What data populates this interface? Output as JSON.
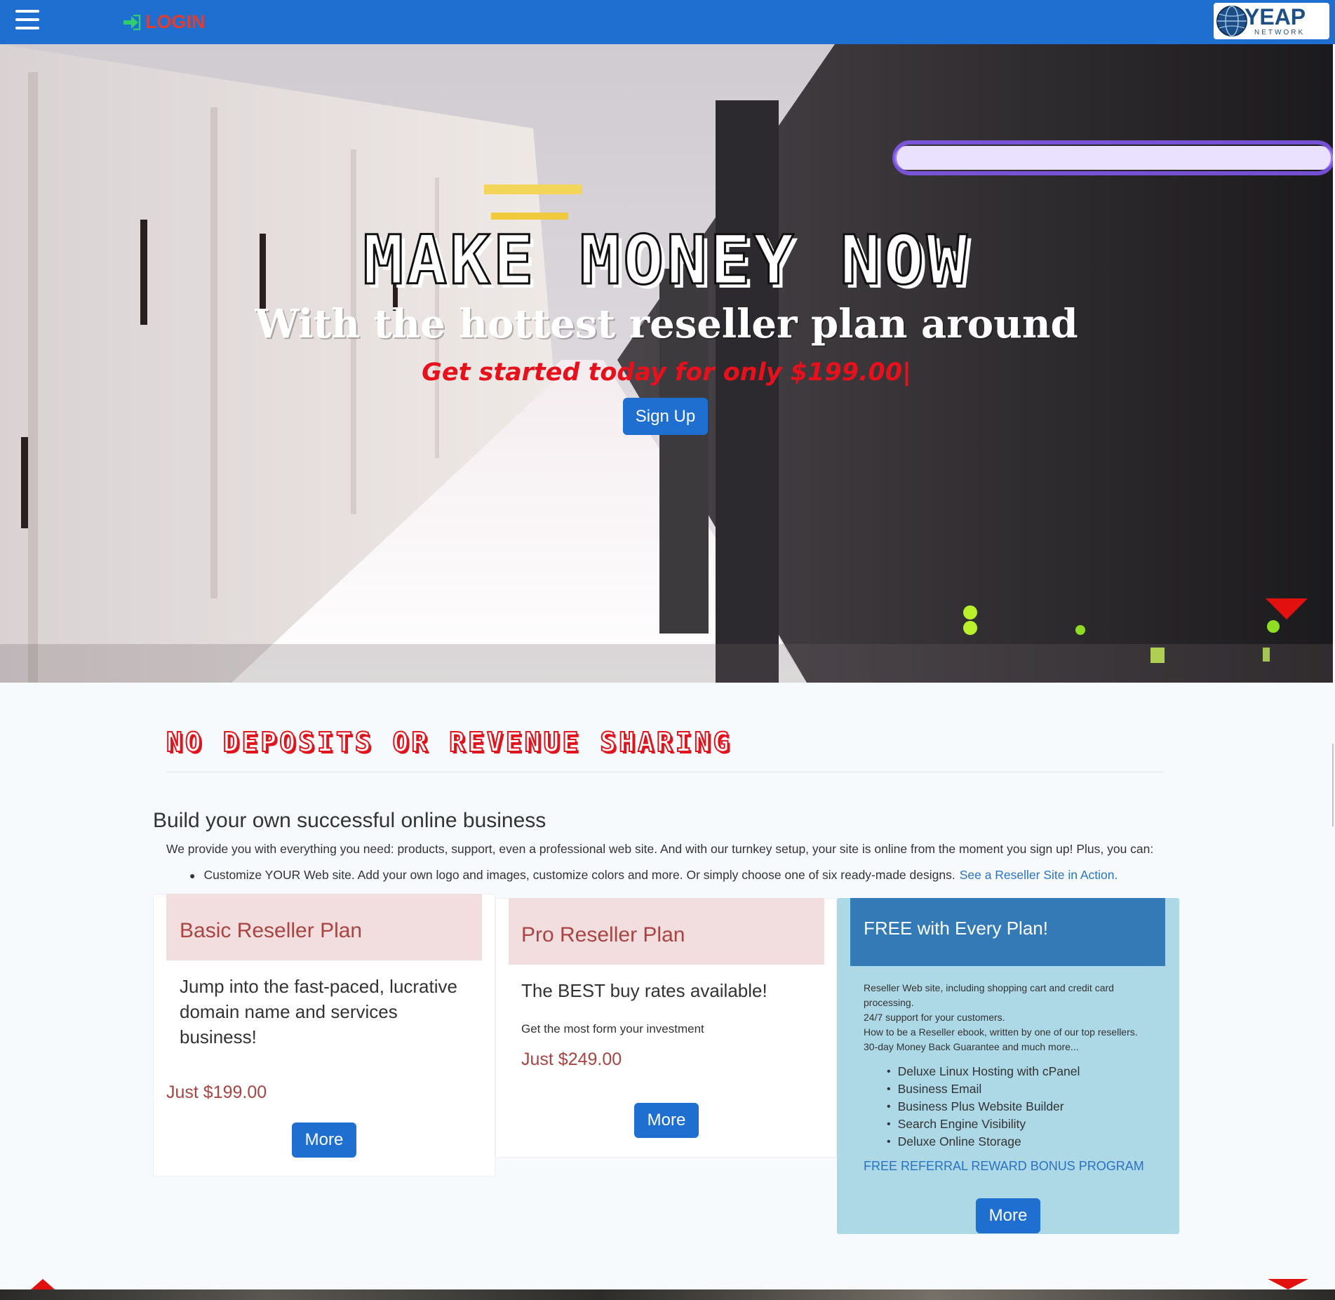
{
  "navbar": {
    "menu_icon": "hamburger-icon",
    "login_icon": "sign-in-icon",
    "login_label": "LOGIN",
    "brand_logo_text": "YEAP",
    "brand_logo_subtext": "NETWORK",
    "colors": {
      "bar": "#1e6fd0",
      "login": "#e53b2c",
      "login_icon": "#2ecc71"
    }
  },
  "hero": {
    "title": "MAKE MONEY NOW",
    "subtitle": "With the hottest reseller plan around",
    "price_line": "Get started today for only $199.00|",
    "signup_label": "Sign Up",
    "scroll_icon": "triangle-down-icon"
  },
  "content": {
    "section_heading": "NO DEPOSITS OR REVENUE SHARING",
    "lead_title": "Build your own successful online business",
    "lead_text": "We provide you with everything you need: products, support, even a professional web site. And with our turnkey setup, your site is online from the moment you sign up! Plus, you can:",
    "bullet_text": "Customize YOUR Web site. Add your own logo and images, customize colors and more. Or simply choose one of six ready-made designs.",
    "bullet_link": "See a Reseller Site in Action."
  },
  "plans": {
    "basic": {
      "title": "Basic Reseller Plan",
      "desc_1": "Jump into the fast-paced, lucrative",
      "desc_2": "domain name and services",
      "desc_3": "business!",
      "price": "Just $199.00",
      "more_label": "More"
    },
    "pro": {
      "title": "Pro Reseller Plan",
      "desc": "The BEST buy rates available!",
      "small": "Get the most form your investment",
      "price": "Just $249.00",
      "more_label": "More"
    },
    "free": {
      "title": "FREE with Every Plan!",
      "desc_lines": [
        "Reseller Web site, including shopping cart and credit card",
        "processing.",
        "24/7 support for your customers.",
        "How to be a Reseller ebook, written by one of our top resellers.",
        "30-day Money Back Guarantee and much more..."
      ],
      "features": [
        "Deluxe Linux Hosting with cPanel",
        "Business Email",
        "Business Plus Website Builder",
        "Search Engine Visibility",
        "Deluxe Online Storage"
      ],
      "referral": "FREE REFERRAL REWARD BONUS PROGRAM",
      "more_label": "More"
    }
  },
  "footer": {
    "up_icon": "triangle-up-icon",
    "down_icon": "triangle-down-icon"
  }
}
